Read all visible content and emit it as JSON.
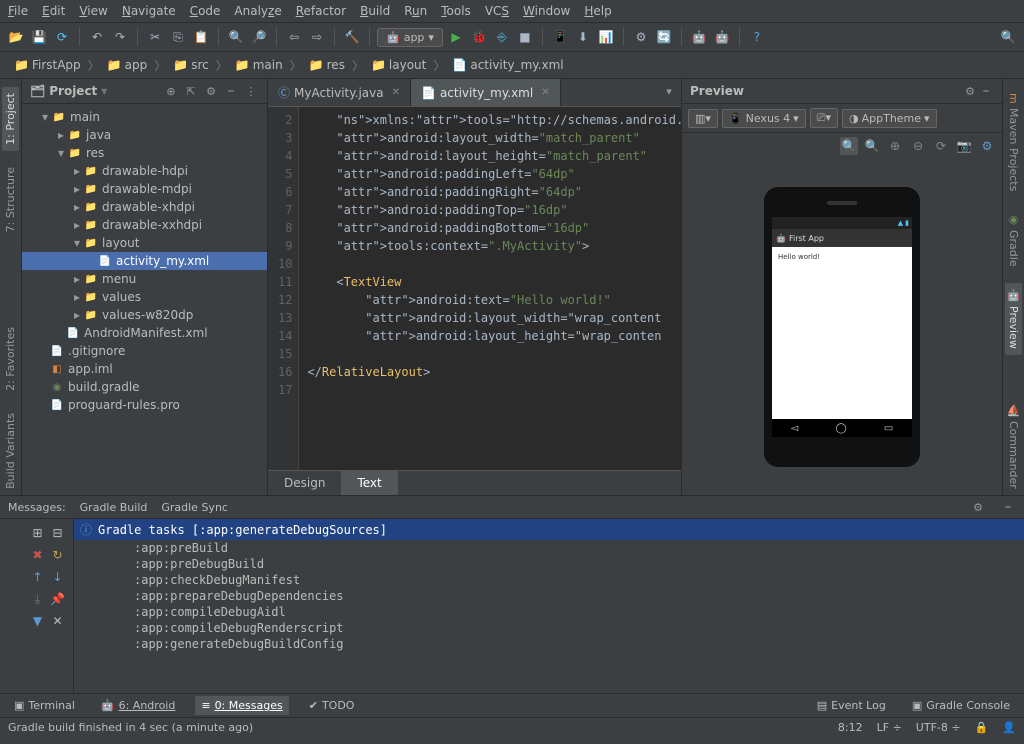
{
  "menu": [
    "File",
    "Edit",
    "View",
    "Navigate",
    "Code",
    "Analyze",
    "Refactor",
    "Build",
    "Run",
    "Tools",
    "VCS",
    "Window",
    "Help"
  ],
  "toolbar": {
    "run_target": "app"
  },
  "breadcrumb": [
    "FirstApp",
    "app",
    "src",
    "main",
    "res",
    "layout",
    "activity_my.xml"
  ],
  "left_tabs": {
    "project": "1: Project",
    "structure": "7: Structure",
    "favorites": "2: Favorites",
    "build_variants": "Build Variants"
  },
  "right_tabs": {
    "maven": "Maven Projects",
    "gradle": "Gradle",
    "preview": "Preview",
    "commander": "Commander"
  },
  "project_panel": {
    "title": "Project",
    "tree": {
      "main": "main",
      "java": "java",
      "res": "res",
      "drawable_hdpi": "drawable-hdpi",
      "drawable_mdpi": "drawable-mdpi",
      "drawable_xhdpi": "drawable-xhdpi",
      "drawable_xxhdpi": "drawable-xxhdpi",
      "layout": "layout",
      "activity_my": "activity_my.xml",
      "menu": "menu",
      "values": "values",
      "values_w820dp": "values-w820dp",
      "manifest": "AndroidManifest.xml",
      "gitignore": ".gitignore",
      "app_iml": "app.iml",
      "build_gradle": "build.gradle",
      "proguard": "proguard-rules.pro"
    }
  },
  "editor_tabs": {
    "t1": "MyActivity.java",
    "t2": "activity_my.xml"
  },
  "code": {
    "lines_start": 2,
    "content": [
      "    xmlns:tools=\"http://schemas.android.co",
      "    android:layout_width=\"match_parent\"",
      "    android:layout_height=\"match_parent\"",
      "    android:paddingLeft=\"64dp\"",
      "    android:paddingRight=\"64dp\"",
      "    android:paddingTop=\"16dp\"",
      "    android:paddingBottom=\"16dp\"",
      "    tools:context=\".MyActivity\">",
      "",
      "    <TextView",
      "        android:text=\"Hello world!\"",
      "        android:layout_width=\"wrap_content",
      "        android:layout_height=\"wrap_conten",
      "",
      "</RelativeLayout>",
      ""
    ]
  },
  "editor_bottom": {
    "design": "Design",
    "text": "Text"
  },
  "preview": {
    "title": "Preview",
    "device": "Nexus 4",
    "theme": "AppTheme",
    "app_name": "First App",
    "body_text": "Hello world!"
  },
  "messages": {
    "header_label": "Messages:",
    "tabs": {
      "gradle_build": "Gradle Build",
      "gradle_sync": "Gradle Sync"
    },
    "title": "Gradle tasks [:app:generateDebugSources]",
    "lines": [
      ":app:preBuild",
      ":app:preDebugBuild",
      ":app:checkDebugManifest",
      ":app:prepareDebugDependencies",
      ":app:compileDebugAidl",
      ":app:compileDebugRenderscript",
      ":app:generateDebugBuildConfig"
    ]
  },
  "bottom_tabs": {
    "terminal": "Terminal",
    "android": "6: Android",
    "messages": "0: Messages",
    "todo": "TODO",
    "event_log": "Event Log",
    "gradle_console": "Gradle Console"
  },
  "status": {
    "msg": "Gradle build finished in 4 sec (a minute ago)",
    "pos": "8:12",
    "sep": "LF",
    "enc": "UTF-8",
    "lock": "🔒"
  }
}
